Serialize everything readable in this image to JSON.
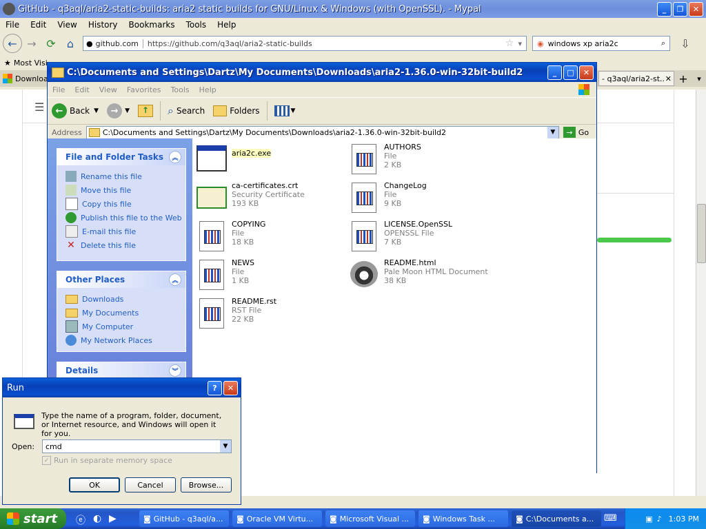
{
  "browser": {
    "title": "GitHub - q3aql/aria2-static-builds: aria2 static builds for GNU/Linux & Windows (with OpenSSL). - Mypal",
    "menu": [
      "File",
      "Edit",
      "View",
      "History",
      "Bookmarks",
      "Tools",
      "Help"
    ],
    "site_identity": "github.com",
    "url": "https://github.com/q3aql/aria2-static-builds",
    "search_value": "windows xp aria2c",
    "bookmark_most_visited": "Most Visi",
    "tab_left": "Downloa",
    "tab_right": "- q3aql/aria2-st...",
    "accent_progress": "#4cc94c"
  },
  "explorer": {
    "title": "C:\\Documents and Settings\\Dartz\\My Documents\\Downloads\\aria2-1.36.0-win-32bit-build2",
    "menu": [
      "File",
      "Edit",
      "View",
      "Favorites",
      "Tools",
      "Help"
    ],
    "toolbar": {
      "back": "Back",
      "search": "Search",
      "folders": "Folders"
    },
    "address_label": "Address",
    "address_value": "C:\\Documents and Settings\\Dartz\\My Documents\\Downloads\\aria2-1.36.0-win-32bit-build2",
    "go_label": "Go",
    "file_tasks": {
      "heading": "File and Folder Tasks",
      "items": [
        "Rename this file",
        "Move this file",
        "Copy this file",
        "Publish this file to the Web",
        "E-mail this file",
        "Delete this file"
      ]
    },
    "other_places": {
      "heading": "Other Places",
      "items": [
        "Downloads",
        "My Documents",
        "My Computer",
        "My Network Places"
      ]
    },
    "details": {
      "heading": "Details"
    },
    "files": [
      {
        "name": "aria2c.exe",
        "type": "",
        "size": ""
      },
      {
        "name": "AUTHORS",
        "type": "File",
        "size": "2 KB"
      },
      {
        "name": "ca-certificates.crt",
        "type": "Security Certificate",
        "size": "193 KB"
      },
      {
        "name": "ChangeLog",
        "type": "File",
        "size": "9 KB"
      },
      {
        "name": "COPYING",
        "type": "File",
        "size": "18 KB"
      },
      {
        "name": "LICENSE.OpenSSL",
        "type": "OPENSSL File",
        "size": "7 KB"
      },
      {
        "name": "NEWS",
        "type": "File",
        "size": "1 KB"
      },
      {
        "name": "README.html",
        "type": "Pale Moon HTML Document",
        "size": "38 KB"
      },
      {
        "name": "README.rst",
        "type": "RST File",
        "size": "22 KB"
      }
    ]
  },
  "run": {
    "title": "Run",
    "description": "Type the name of a program, folder, document, or Internet resource, and Windows will open it for you.",
    "open_label": "Open:",
    "open_value": "cmd",
    "separate_memory_label": "Run in separate memory space",
    "ok": "OK",
    "cancel": "Cancel",
    "browse": "Browse..."
  },
  "taskbar": {
    "start": "start",
    "buttons": [
      "GitHub - q3aql/a...",
      "Oracle VM Virtu...",
      "Microsoft Visual ...",
      "Windows Task ...",
      "C:\\Documents a..."
    ],
    "clock": "1:03 PM"
  }
}
